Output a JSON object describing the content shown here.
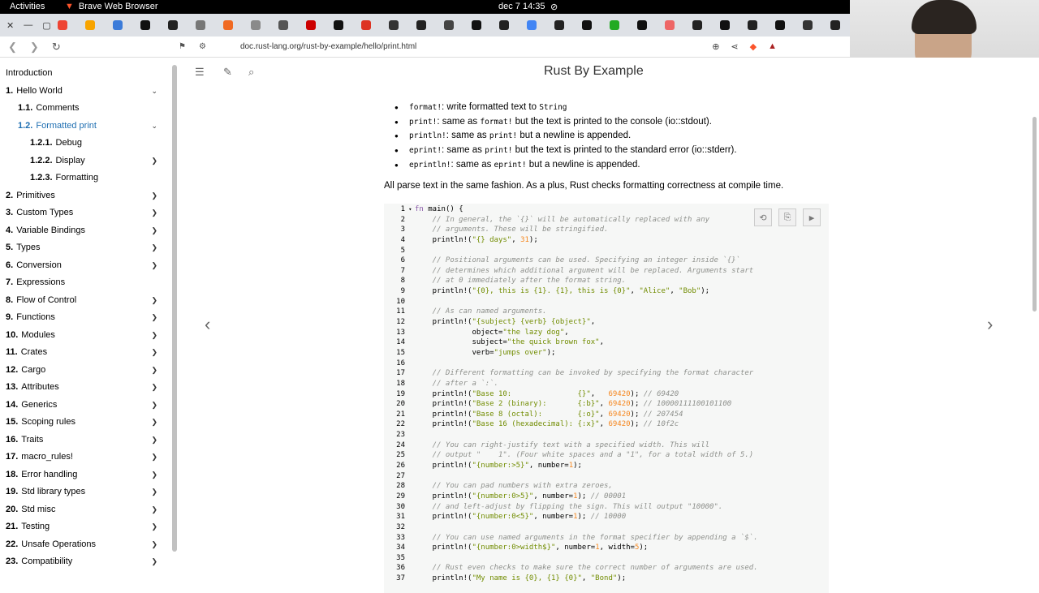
{
  "system": {
    "activities": "Activities",
    "app_name": "Brave Web Browser",
    "clock": "dec 7  14:35"
  },
  "browser": {
    "url": "doc.rust-lang.org/rust-by-example/hello/print.html",
    "tab_favicons": [
      "#e43",
      "#f8a400",
      "#3b7bd9",
      "#111",
      "#222",
      "#777",
      "#f06a23",
      "#8a8a8a",
      "#555",
      "#c00",
      "#111",
      "#d32",
      "#333",
      "#222",
      "#444",
      "#111",
      "#222",
      "#4285f4",
      "#222",
      "#111",
      "#2a2",
      "#111",
      "#e66",
      "#222",
      "#111",
      "#222",
      "#111",
      "#333",
      "#222",
      "#111",
      "#222",
      "#4285f4"
    ]
  },
  "book": {
    "title": "Rust By Example"
  },
  "sidebar": {
    "items": [
      {
        "num": "",
        "label": "Introduction",
        "indent": 0,
        "chev": ""
      },
      {
        "num": "1.",
        "label": "Hello World",
        "indent": 0,
        "chev": "⌄"
      },
      {
        "num": "1.1.",
        "label": "Comments",
        "indent": 1,
        "chev": ""
      },
      {
        "num": "1.2.",
        "label": "Formatted print",
        "indent": 1,
        "chev": "⌄",
        "active": true
      },
      {
        "num": "1.2.1.",
        "label": "Debug",
        "indent": 2,
        "chev": ""
      },
      {
        "num": "1.2.2.",
        "label": "Display",
        "indent": 2,
        "chev": "❯"
      },
      {
        "num": "1.2.3.",
        "label": "Formatting",
        "indent": 2,
        "chev": ""
      },
      {
        "num": "2.",
        "label": "Primitives",
        "indent": 0,
        "chev": "❯"
      },
      {
        "num": "3.",
        "label": "Custom Types",
        "indent": 0,
        "chev": "❯"
      },
      {
        "num": "4.",
        "label": "Variable Bindings",
        "indent": 0,
        "chev": "❯"
      },
      {
        "num": "5.",
        "label": "Types",
        "indent": 0,
        "chev": "❯"
      },
      {
        "num": "6.",
        "label": "Conversion",
        "indent": 0,
        "chev": "❯"
      },
      {
        "num": "7.",
        "label": "Expressions",
        "indent": 0,
        "chev": ""
      },
      {
        "num": "8.",
        "label": "Flow of Control",
        "indent": 0,
        "chev": "❯"
      },
      {
        "num": "9.",
        "label": "Functions",
        "indent": 0,
        "chev": "❯"
      },
      {
        "num": "10.",
        "label": "Modules",
        "indent": 0,
        "chev": "❯"
      },
      {
        "num": "11.",
        "label": "Crates",
        "indent": 0,
        "chev": "❯"
      },
      {
        "num": "12.",
        "label": "Cargo",
        "indent": 0,
        "chev": "❯"
      },
      {
        "num": "13.",
        "label": "Attributes",
        "indent": 0,
        "chev": "❯"
      },
      {
        "num": "14.",
        "label": "Generics",
        "indent": 0,
        "chev": "❯"
      },
      {
        "num": "15.",
        "label": "Scoping rules",
        "indent": 0,
        "chev": "❯"
      },
      {
        "num": "16.",
        "label": "Traits",
        "indent": 0,
        "chev": "❯"
      },
      {
        "num": "17.",
        "label": "macro_rules!",
        "indent": 0,
        "chev": "❯"
      },
      {
        "num": "18.",
        "label": "Error handling",
        "indent": 0,
        "chev": "❯"
      },
      {
        "num": "19.",
        "label": "Std library types",
        "indent": 0,
        "chev": "❯"
      },
      {
        "num": "20.",
        "label": "Std misc",
        "indent": 0,
        "chev": "❯"
      },
      {
        "num": "21.",
        "label": "Testing",
        "indent": 0,
        "chev": "❯"
      },
      {
        "num": "22.",
        "label": "Unsafe Operations",
        "indent": 0,
        "chev": "❯"
      },
      {
        "num": "23.",
        "label": "Compatibility",
        "indent": 0,
        "chev": "❯"
      }
    ]
  },
  "bullets": [
    {
      "code": "format!",
      "text": ": write formatted text to ",
      "code2": "String",
      "text2": ""
    },
    {
      "code": "print!",
      "text": ": same as ",
      "code2": "format!",
      "text2": " but the text is printed to the console (io::stdout)."
    },
    {
      "code": "println!",
      "text": ": same as ",
      "code2": "print!",
      "text2": " but a newline is appended."
    },
    {
      "code": "eprint!",
      "text": ": same as ",
      "code2": "print!",
      "text2": " but the text is printed to the standard error (io::stderr)."
    },
    {
      "code": "eprintln!",
      "text": ": same as ",
      "code2": "eprint!",
      "text2": " but a newline is appended."
    }
  ],
  "parse_text": "All parse text in the same fashion. As a plus, Rust checks formatting correctness at compile time.",
  "code_lines": [
    [
      [
        "fn ",
        "ck"
      ],
      [
        "main() {",
        ""
      ]
    ],
    [
      [
        "    // In general, the `{}` will be automatically replaced with any",
        "cc"
      ]
    ],
    [
      [
        "    // arguments. These will be stringified.",
        "cc"
      ]
    ],
    [
      [
        "    println!(",
        ""
      ],
      [
        "\"{} days\"",
        "cs"
      ],
      [
        ", ",
        ""
      ],
      [
        "31",
        "cn"
      ],
      [
        ");",
        ""
      ]
    ],
    [],
    [
      [
        "    // Positional arguments can be used. Specifying an integer inside `{}`",
        "cc"
      ]
    ],
    [
      [
        "    // determines which additional argument will be replaced. Arguments start",
        "cc"
      ]
    ],
    [
      [
        "    // at 0 immediately after the format string.",
        "cc"
      ]
    ],
    [
      [
        "    println!(",
        ""
      ],
      [
        "\"{0}, this is {1}. {1}, this is {0}\"",
        "cs"
      ],
      [
        ", ",
        ""
      ],
      [
        "\"Alice\"",
        "cs"
      ],
      [
        ", ",
        ""
      ],
      [
        "\"Bob\"",
        "cs"
      ],
      [
        ");",
        ""
      ]
    ],
    [],
    [
      [
        "    // As can named arguments.",
        "cc"
      ]
    ],
    [
      [
        "    println!(",
        ""
      ],
      [
        "\"{subject} {verb} {object}\"",
        "cs"
      ],
      [
        ",",
        ""
      ]
    ],
    [
      [
        "             object=",
        ""
      ],
      [
        "\"the lazy dog\"",
        "cs"
      ],
      [
        ",",
        ""
      ]
    ],
    [
      [
        "             subject=",
        ""
      ],
      [
        "\"the quick brown fox\"",
        "cs"
      ],
      [
        ",",
        ""
      ]
    ],
    [
      [
        "             verb=",
        ""
      ],
      [
        "\"jumps over\"",
        "cs"
      ],
      [
        ");",
        ""
      ]
    ],
    [],
    [
      [
        "    // Different formatting can be invoked by specifying the format character",
        "cc"
      ]
    ],
    [
      [
        "    // after a `:`.",
        "cc"
      ]
    ],
    [
      [
        "    println!(",
        ""
      ],
      [
        "\"Base 10:               {}\"",
        "cs"
      ],
      [
        ",   ",
        ""
      ],
      [
        "69420",
        "cn"
      ],
      [
        "); ",
        ""
      ],
      [
        "// 69420",
        "cc"
      ]
    ],
    [
      [
        "    println!(",
        ""
      ],
      [
        "\"Base 2 (binary):       {:b}\"",
        "cs"
      ],
      [
        ", ",
        ""
      ],
      [
        "69420",
        "cn"
      ],
      [
        "); ",
        ""
      ],
      [
        "// 10000111100101100",
        "cc"
      ]
    ],
    [
      [
        "    println!(",
        ""
      ],
      [
        "\"Base 8 (octal):        {:o}\"",
        "cs"
      ],
      [
        ", ",
        ""
      ],
      [
        "69420",
        "cn"
      ],
      [
        "); ",
        ""
      ],
      [
        "// 207454",
        "cc"
      ]
    ],
    [
      [
        "    println!(",
        ""
      ],
      [
        "\"Base 16 (hexadecimal): {:x}\"",
        "cs"
      ],
      [
        ", ",
        ""
      ],
      [
        "69420",
        "cn"
      ],
      [
        "); ",
        ""
      ],
      [
        "// 10f2c",
        "cc"
      ]
    ],
    [],
    [
      [
        "    // You can right-justify text with a specified width. This will",
        "cc"
      ]
    ],
    [
      [
        "    // output \"    1\". (Four white spaces and a \"1\", for a total width of 5.)",
        "cc"
      ]
    ],
    [
      [
        "    println!(",
        ""
      ],
      [
        "\"{number:>5}\"",
        "cs"
      ],
      [
        ", number=",
        ""
      ],
      [
        "1",
        "cn"
      ],
      [
        ");",
        ""
      ]
    ],
    [],
    [
      [
        "    // You can pad numbers with extra zeroes,",
        "cc"
      ]
    ],
    [
      [
        "    println!(",
        ""
      ],
      [
        "\"{number:0>5}\"",
        "cs"
      ],
      [
        ", number=",
        ""
      ],
      [
        "1",
        "cn"
      ],
      [
        "); ",
        ""
      ],
      [
        "// 00001",
        "cc"
      ]
    ],
    [
      [
        "    // and left-adjust by flipping the sign. This will output \"10000\".",
        "cc"
      ]
    ],
    [
      [
        "    println!(",
        ""
      ],
      [
        "\"{number:0<5}\"",
        "cs"
      ],
      [
        ", number=",
        ""
      ],
      [
        "1",
        "cn"
      ],
      [
        "); ",
        ""
      ],
      [
        "// 10000",
        "cc"
      ]
    ],
    [],
    [
      [
        "    // You can use named arguments in the format specifier by appending a `$`.",
        "cc"
      ]
    ],
    [
      [
        "    println!(",
        ""
      ],
      [
        "\"{number:0>width$}\"",
        "cs"
      ],
      [
        ", number=",
        ""
      ],
      [
        "1",
        "cn"
      ],
      [
        ", width=",
        ""
      ],
      [
        "5",
        "cn"
      ],
      [
        ");",
        ""
      ]
    ],
    [],
    [
      [
        "    // Rust even checks to make sure the correct number of arguments are used.",
        "cc"
      ]
    ],
    [
      [
        "    println!(",
        ""
      ],
      [
        "\"My name is {0}, {1} {0}\"",
        "cs"
      ],
      [
        ", ",
        ""
      ],
      [
        "\"Bond\"",
        "cs"
      ],
      [
        ");",
        ""
      ]
    ]
  ]
}
